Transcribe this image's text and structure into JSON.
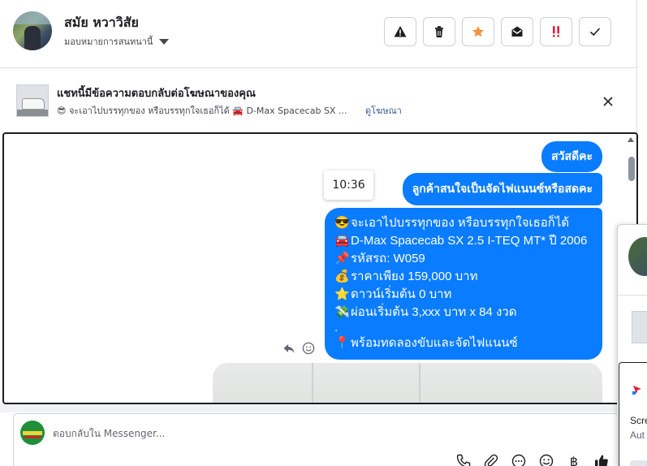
{
  "header": {
    "user_name": "สมัย หวาวิสัย",
    "assign_label": "มอบหมายการสนทนานี้",
    "actions": [
      {
        "name": "report-button",
        "icon": "warning-icon"
      },
      {
        "name": "delete-button",
        "icon": "trash-icon"
      },
      {
        "name": "star-button",
        "icon": "star-icon",
        "color": "#f7923b"
      },
      {
        "name": "mark-unread-button",
        "icon": "envelope-open-icon"
      },
      {
        "name": "spam-button",
        "icon": "double-exclamation-icon",
        "color": "#e41e3f"
      },
      {
        "name": "done-button",
        "icon": "check-icon"
      }
    ]
  },
  "ad_banner": {
    "title": "แชทนี้มีข้อความตอบกลับต่อโฆษณาของคุณ",
    "subtitle": "😎 จะเอาไปบรรทุกของ หรือบรรทุกใจเธอก็ได้ 🚘 D-Max Spacecab SX ...",
    "link": "ดูโฆษณา"
  },
  "chat": {
    "timestamp_tooltip": "10:36",
    "messages": [
      {
        "text": "สวัสดีคะ"
      },
      {
        "text": "ลูกค้าสนใจเป็นจัดไฟแนนซ์หรือสดคะ"
      }
    ],
    "ad_message": [
      {
        "emoji": "😎",
        "text": "จะเอาไปบรรทุกของ หรือบรรทุกใจเธอก็ได้"
      },
      {
        "emoji": "🚘",
        "text": "D-Max Spacecab SX 2.5 I-TEQ MT* ปี 2006"
      },
      {
        "emoji": "📌",
        "text": "รหัสรถ: W059"
      },
      {
        "emoji": "💰",
        "text": "ราคาเพียง 159,000 บาท"
      },
      {
        "emoji": "⭐",
        "text": "ดาวน์เริ่มต้น 0 บาท"
      },
      {
        "emoji": "💸",
        "text": "ผ่อนเริ่มต้น 3,xxx บาท x 84 งวด"
      },
      {
        "emoji": "",
        "text": "."
      },
      {
        "emoji": "📍",
        "text": "พร้อมทดลองขับและจัดไฟแนนซ์"
      }
    ]
  },
  "composer": {
    "placeholder": "ตอบกลับใน Messenger...",
    "tools": [
      "phone-icon",
      "paperclip-icon",
      "saved-replies-icon",
      "emoji-icon",
      "baht-icon",
      "like-icon"
    ],
    "baht_symbol": "฿"
  },
  "notification": {
    "line1": "Scre",
    "line2": "Aut"
  }
}
